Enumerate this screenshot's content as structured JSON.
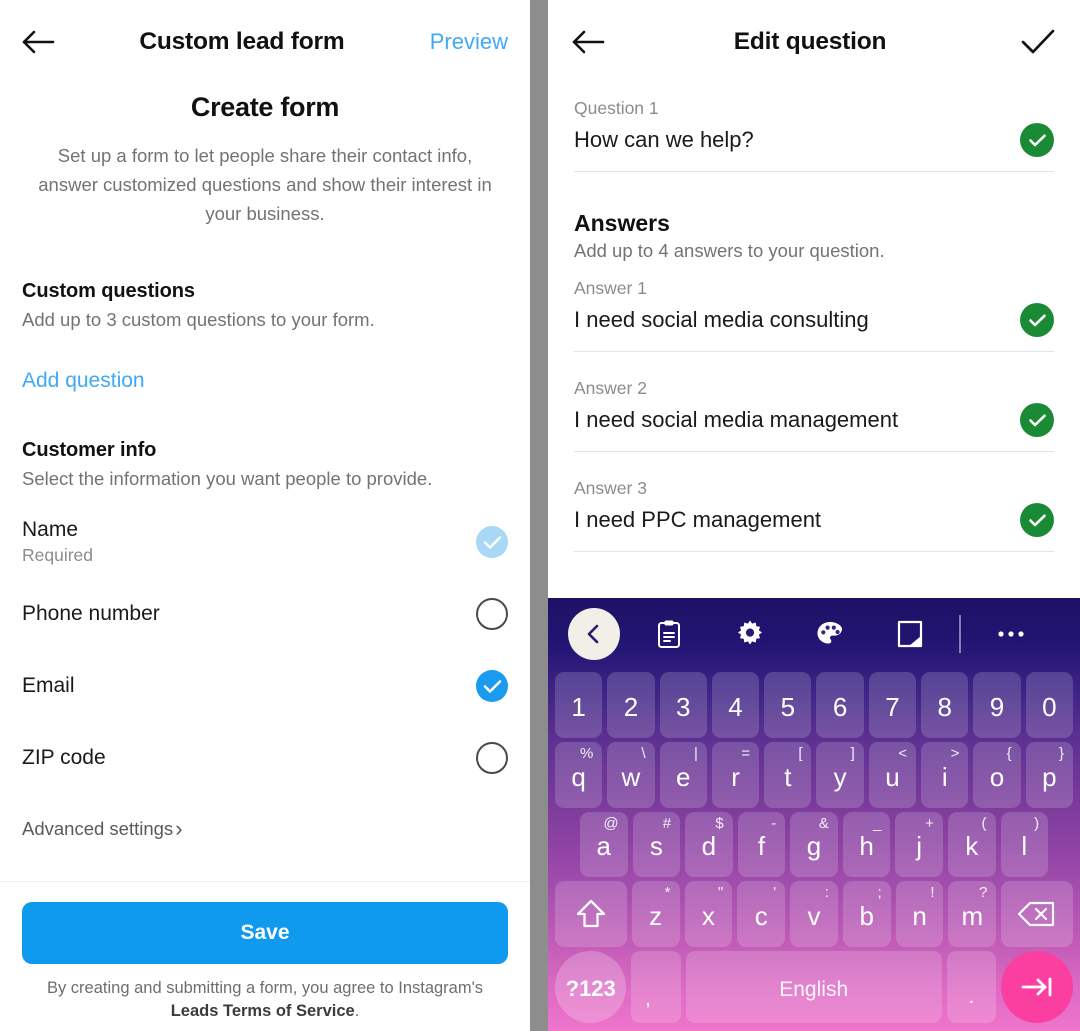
{
  "left": {
    "header": {
      "back_icon": "arrow-left-icon",
      "title": "Custom lead form",
      "preview": "Preview"
    },
    "create_title": "Create form",
    "create_desc": "Set up a form to let people share their contact info, answer customized questions and show their interest in your business.",
    "custom_questions": {
      "title": "Custom questions",
      "subtitle": "Add up to 3 custom questions to your form.",
      "add_link": "Add question"
    },
    "customer_info": {
      "title": "Customer info",
      "subtitle": "Select the information you want people to provide.",
      "rows": [
        {
          "label": "Name",
          "note": "Required",
          "state": "locked"
        },
        {
          "label": "Phone number",
          "note": "",
          "state": "off"
        },
        {
          "label": "Email",
          "note": "",
          "state": "on"
        },
        {
          "label": "ZIP code",
          "note": "",
          "state": "off"
        }
      ]
    },
    "advanced_settings": "Advanced settings",
    "advanced_chevron": "›",
    "save_label": "Save",
    "tos_prefix": "By creating and submitting a form, you agree to Instagram's ",
    "tos_link": "Leads Terms of Service",
    "tos_suffix": "."
  },
  "right": {
    "header": {
      "back_icon": "arrow-left-icon",
      "title": "Edit question",
      "confirm_icon": "check-icon"
    },
    "question": {
      "label": "Question 1",
      "value": "How can we help?"
    },
    "answers": {
      "title": "Answers",
      "subtitle": "Add up to 4 answers to your question.",
      "items": [
        {
          "label": "Answer 1",
          "value": "I need social media consulting"
        },
        {
          "label": "Answer 2",
          "value": "I need social media management"
        },
        {
          "label": "Answer 3",
          "value": "I need PPC management"
        }
      ]
    }
  },
  "keyboard": {
    "toolbar": [
      {
        "icon": "chevron-left-icon",
        "style": "circle"
      },
      {
        "icon": "clipboard-icon",
        "style": "plain"
      },
      {
        "icon": "gear-icon",
        "style": "plain"
      },
      {
        "icon": "palette-icon",
        "style": "plain"
      },
      {
        "icon": "resize-keyboard-icon",
        "style": "plain"
      },
      {
        "icon": "divider",
        "style": "sep"
      },
      {
        "icon": "overflow-dots-icon",
        "style": "plain"
      }
    ],
    "row_numbers": [
      {
        "main": "1",
        "sec": ""
      },
      {
        "main": "2",
        "sec": ""
      },
      {
        "main": "3",
        "sec": ""
      },
      {
        "main": "4",
        "sec": ""
      },
      {
        "main": "5",
        "sec": ""
      },
      {
        "main": "6",
        "sec": ""
      },
      {
        "main": "7",
        "sec": ""
      },
      {
        "main": "8",
        "sec": ""
      },
      {
        "main": "9",
        "sec": ""
      },
      {
        "main": "0",
        "sec": ""
      }
    ],
    "row_top": [
      {
        "main": "q",
        "sec": "%"
      },
      {
        "main": "w",
        "sec": "\\"
      },
      {
        "main": "e",
        "sec": "|"
      },
      {
        "main": "r",
        "sec": "="
      },
      {
        "main": "t",
        "sec": "["
      },
      {
        "main": "y",
        "sec": "]"
      },
      {
        "main": "u",
        "sec": "<"
      },
      {
        "main": "i",
        "sec": ">"
      },
      {
        "main": "o",
        "sec": "{"
      },
      {
        "main": "p",
        "sec": "}"
      }
    ],
    "row_home": [
      {
        "main": "a",
        "sec": "@"
      },
      {
        "main": "s",
        "sec": "#"
      },
      {
        "main": "d",
        "sec": "$"
      },
      {
        "main": "f",
        "sec": "-"
      },
      {
        "main": "g",
        "sec": "&"
      },
      {
        "main": "h",
        "sec": "_"
      },
      {
        "main": "j",
        "sec": "+"
      },
      {
        "main": "k",
        "sec": "("
      },
      {
        "main": "l",
        "sec": ")"
      }
    ],
    "row_bottom": [
      {
        "main": "z",
        "sec": "*"
      },
      {
        "main": "x",
        "sec": "\""
      },
      {
        "main": "c",
        "sec": "'"
      },
      {
        "main": "v",
        "sec": ":"
      },
      {
        "main": "b",
        "sec": ";"
      },
      {
        "main": "n",
        "sec": "!"
      },
      {
        "main": "m",
        "sec": "?"
      }
    ],
    "shift_icon": "shift-icon",
    "backspace_icon": "backspace-icon",
    "symbols_key": "?123",
    "comma_key": ",",
    "space_key": "English",
    "period_key": ".",
    "enter_icon": "tab-enter-icon"
  },
  "colors": {
    "accent_blue": "#0f9af0",
    "link_blue": "#3fa9f5",
    "check_green": "#1b8a35",
    "enter_pink": "#fa3fa0",
    "locked_blue": "#a8d8f5"
  }
}
